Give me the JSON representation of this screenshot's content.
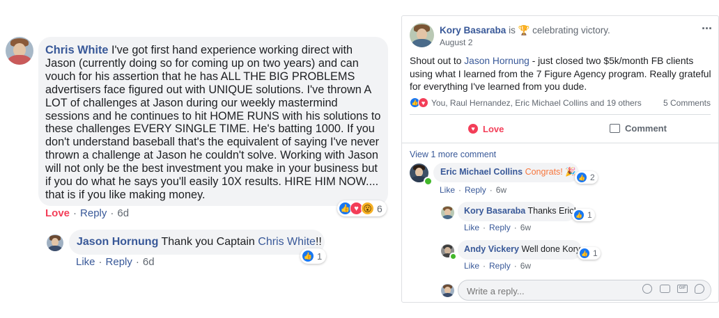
{
  "left_thread": {
    "main_comment": {
      "author": "Chris White",
      "text": "I've got first hand experience working direct with Jason (currently doing so for coming up on two years) and can vouch for his assertion that he has ALL THE BIG PROBLEMS advertisers face figured out with UNIQUE solutions. I've thrown A LOT of challenges at Jason during our weekly mastermind sessions and he continues to hit HOME RUNS with his solutions to these challenges EVERY SINGLE TIME. He's batting 1000. If you don't understand baseball that's the equivalent of saying I've never thrown a challenge at Jason he couldn't solve. Working with Jason will not only be the best investment you make in your business but if you do what he says you'll easily 10X results. HIRE HIM NOW.... that is if you like making money.",
      "love_label": "Love",
      "reply_label": "Reply",
      "time": "6d",
      "reaction_count": "6",
      "reactions": [
        "like",
        "love",
        "wow"
      ]
    },
    "reply": {
      "author": "Jason Hornung",
      "text_before": "Thank you Captain",
      "mention": "Chris White",
      "text_after": "!!",
      "like_label": "Like",
      "reply_label": "Reply",
      "time": "6d",
      "reaction_count": "1"
    }
  },
  "post": {
    "author": "Kory Basaraba",
    "status_word": "is",
    "activity_icon": "trophy-icon",
    "activity": "celebrating victory.",
    "date": "August 2",
    "text_before": "Shout out to",
    "mention": "Jason Hornung",
    "text_after": "- just closed two $5k/month FB clients using what I learned from the 7 Figure Agency program. Really grateful for everything I've learned from you dude.",
    "reactors": "You, Raul Hernandez, Eric Michael Collins and 19 others",
    "comments_count": "5 Comments",
    "love_button": "Love",
    "comment_button": "Comment",
    "view_more": "View 1 more comment",
    "comments": [
      {
        "author": "Eric Michael Collins",
        "text": "Congrats!",
        "emoji": "party-popper-icon",
        "reaction_count": "2",
        "like": "Like",
        "reply": "Reply",
        "time": "6w"
      },
      {
        "author": "Kory Basaraba",
        "text": "Thanks Eric!",
        "reaction_count": "1",
        "like": "Like",
        "reply": "Reply",
        "time": "6w"
      },
      {
        "author": "Andy Vickery",
        "text": "Well done Kory",
        "reaction_count": "1",
        "like": "Like",
        "reply": "Reply",
        "time": "6w"
      }
    ],
    "reply_placeholder": "Write a reply..."
  },
  "colors": {
    "link": "#385898",
    "love": "#f33e58",
    "bubble": "#f2f3f5",
    "like": "#1877f2"
  }
}
